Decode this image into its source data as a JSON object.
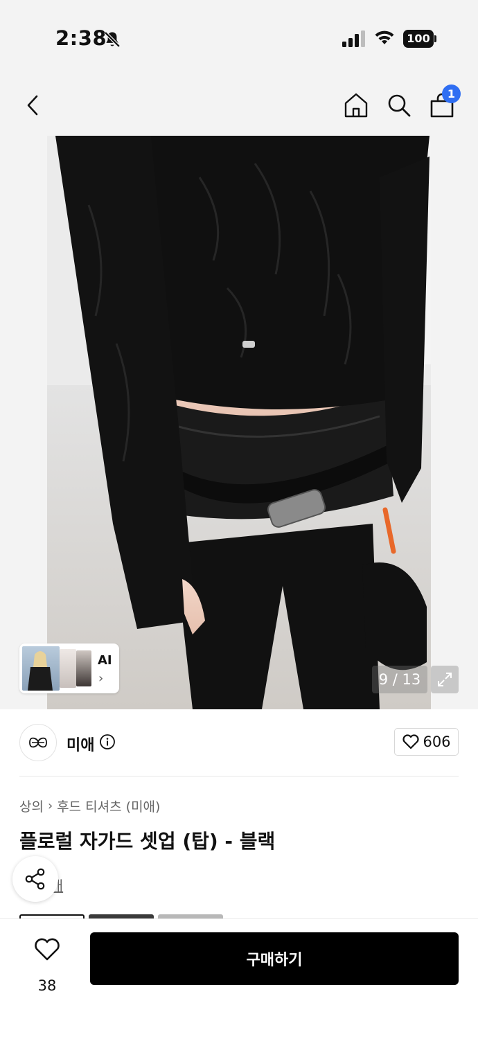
{
  "status_bar": {
    "time": "2:38",
    "battery": "100",
    "icons": [
      "bell-slash-icon",
      "signal-icon",
      "wifi-icon",
      "battery-icon"
    ]
  },
  "nav": {
    "back_icon": "chevron-left-icon",
    "home_icon": "home-icon",
    "search_icon": "search-icon",
    "cart_icon": "shopping-bag-icon",
    "cart_badge": "1",
    "accent_color": "#2f6ef2"
  },
  "gallery": {
    "ai_label": "AI",
    "ai_chevron": "›",
    "page_counter": "9 / 13",
    "expand_icon": "expand-icon"
  },
  "brand": {
    "name": "미애",
    "info_icon": "info-icon",
    "like_count": "606"
  },
  "product": {
    "breadcrumb": [
      "상의",
      "후드 티셔츠 (미애)"
    ],
    "breadcrumb_sep": "›",
    "title": "플로럴 자가드 셋업 (탑) - 블랙",
    "review_text": "2개"
  },
  "bottom_bar": {
    "wish_count": "38",
    "buy_label": "구매하기"
  }
}
